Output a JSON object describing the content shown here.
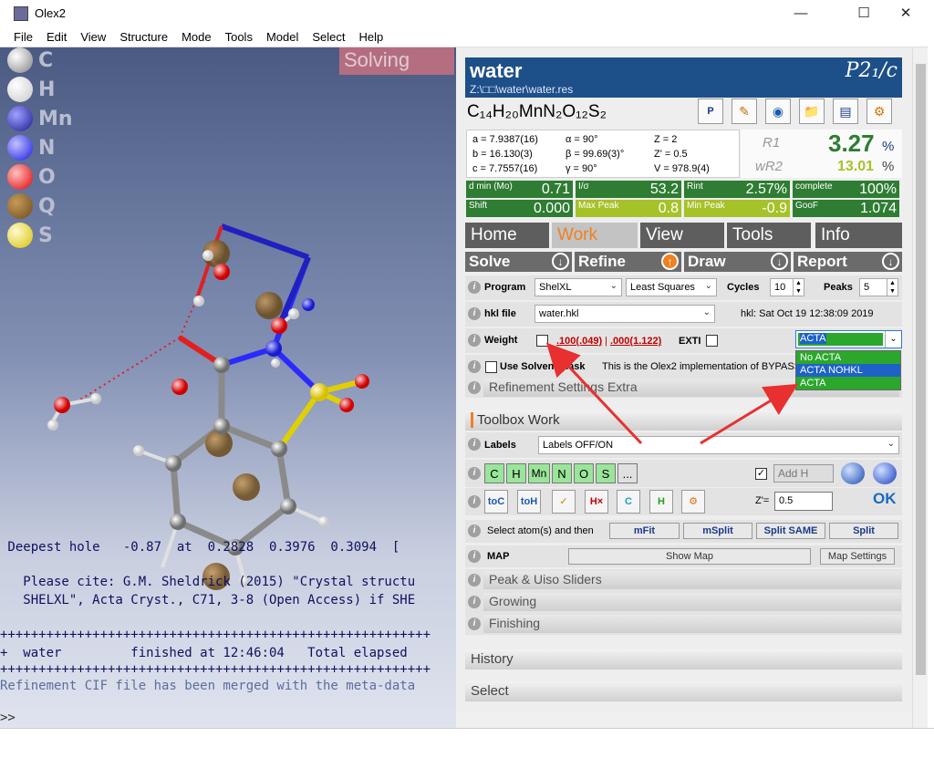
{
  "window": {
    "title": "Olex2",
    "minimize_icon": "minimize-icon",
    "maximize_icon": "maximize-icon",
    "close_icon": "close-icon"
  },
  "menu": [
    "File",
    "Edit",
    "View",
    "Structure",
    "Mode",
    "Tools",
    "Model",
    "Select",
    "Help"
  ],
  "viewport": {
    "overlay": "Solving",
    "elements": [
      {
        "label": "C",
        "color": "#9a9a9a"
      },
      {
        "label": "H",
        "color": "#f2f2f2"
      },
      {
        "label": "Mn",
        "color": "#2020a8"
      },
      {
        "label": "N",
        "color": "#2a2aff"
      },
      {
        "label": "O",
        "color": "#ff1a1a"
      },
      {
        "label": "Q",
        "color": "#8b5a1a"
      },
      {
        "label": "S",
        "color": "#f2e020"
      }
    ],
    "console": [
      " Deepest hole   -0.87  at  0.2828  0.3976  0.3094  [",
      "",
      "   Please cite: G.M. Sheldrick (2015) \"Crystal structu",
      "   SHELXL\", Acta Cryst., C71, 3-8 (Open Access) if SHE",
      "",
      "++++++++++++++++++++++++++++++++++++++++++++++++++++++++",
      "+  water         finished at 12:46:04   Total elapsed",
      "++++++++++++++++++++++++++++++++++++++++++++++++++++++++",
      "Refinement CIF file has been merged with the meta-data"
    ],
    "prompt": ">>"
  },
  "header": {
    "name": "water",
    "path": "Z:\\□□\\water\\water.res",
    "space_group": "P2₁/c",
    "formula": "C₁₄H₂₀MnN₂O₁₂S₂"
  },
  "toolbar_icons": [
    "P TON",
    "pencil-icon",
    "sphere-icon",
    "folder-icon",
    "notepad-icon",
    "gear-icon"
  ],
  "cell": {
    "a": "a = 7.9387(16)",
    "b": "b = 16.130(3)",
    "c": "c = 7.7557(16)",
    "alpha": "α = 90°",
    "beta": "β = 99.69(3)°",
    "gamma": "γ = 90°",
    "Z": "Z = 2",
    "Zp": "Z' = 0.5",
    "V": "V = 978.9(4)"
  },
  "r_values": {
    "r1_label": "R1",
    "r1": "3.27",
    "wr2_label": "wR2",
    "wr2": "13.01",
    "pct": "%"
  },
  "stats": [
    {
      "key": "d min (Mo)",
      "val": "0.71"
    },
    {
      "key": "I/σ",
      "val": "53.2"
    },
    {
      "key": "Rint",
      "val": "2.57%"
    },
    {
      "key": "complete",
      "val": "100%"
    },
    {
      "key": "Shift",
      "val": "0.000"
    },
    {
      "key": "Max Peak",
      "val": "0.8"
    },
    {
      "key": "Min Peak",
      "val": "-0.9"
    },
    {
      "key": "GooF",
      "val": "1.074"
    }
  ],
  "tabs": [
    "Home",
    "Work",
    "View",
    "Tools",
    "Info"
  ],
  "subtabs": [
    "Solve",
    "Refine",
    "Draw",
    "Report"
  ],
  "refine": {
    "program_label": "Program",
    "program": "ShelXL",
    "method": "Least Squares",
    "cycles_label": "Cycles",
    "cycles": "10",
    "peaks_label": "Peaks",
    "peaks": "5",
    "hkl_label": "hkl file",
    "hkl_file": "water.hkl",
    "hkl_info": "hkl: Sat Oct 19 12:38:09 2019",
    "weight_label": "Weight",
    "weight_a": ".100(.049)",
    "weight_sep": "|",
    "weight_b": ".000(1.122)",
    "exti_label": "EXTI",
    "acta_value": "ACTA",
    "acta_options": [
      "No ACTA",
      "ACTA NOHKL",
      "ACTA"
    ],
    "solvent_mask_label": "Use Solvent Mask",
    "solvent_mask_text": "This is the Olex2 implementation of BYPASS",
    "extra": "Refinement Settings Extra"
  },
  "toolbox": {
    "title": "Toolbox Work",
    "labels_label": "Labels",
    "labels_value": "Labels OFF/ON",
    "elements": [
      "C",
      "H",
      "Mn",
      "N",
      "O",
      "S",
      "..."
    ],
    "add_h": "Add H",
    "tools": [
      "toC",
      "toH",
      "broom",
      "H×",
      "C",
      "H",
      "gear"
    ],
    "zprime_label": "Z'=",
    "zprime": "0.5",
    "ok": "OK",
    "select_text": "Select atom(s) and then",
    "buttons": [
      "mFit",
      "mSplit",
      "Split SAME",
      "Split"
    ],
    "map_label": "MAP",
    "show_map": "Show Map",
    "map_settings": "Map Settings",
    "collapsed": [
      "Peak & Uiso Sliders",
      "Growing",
      "Finishing"
    ]
  },
  "sections": [
    "History",
    "Select"
  ]
}
